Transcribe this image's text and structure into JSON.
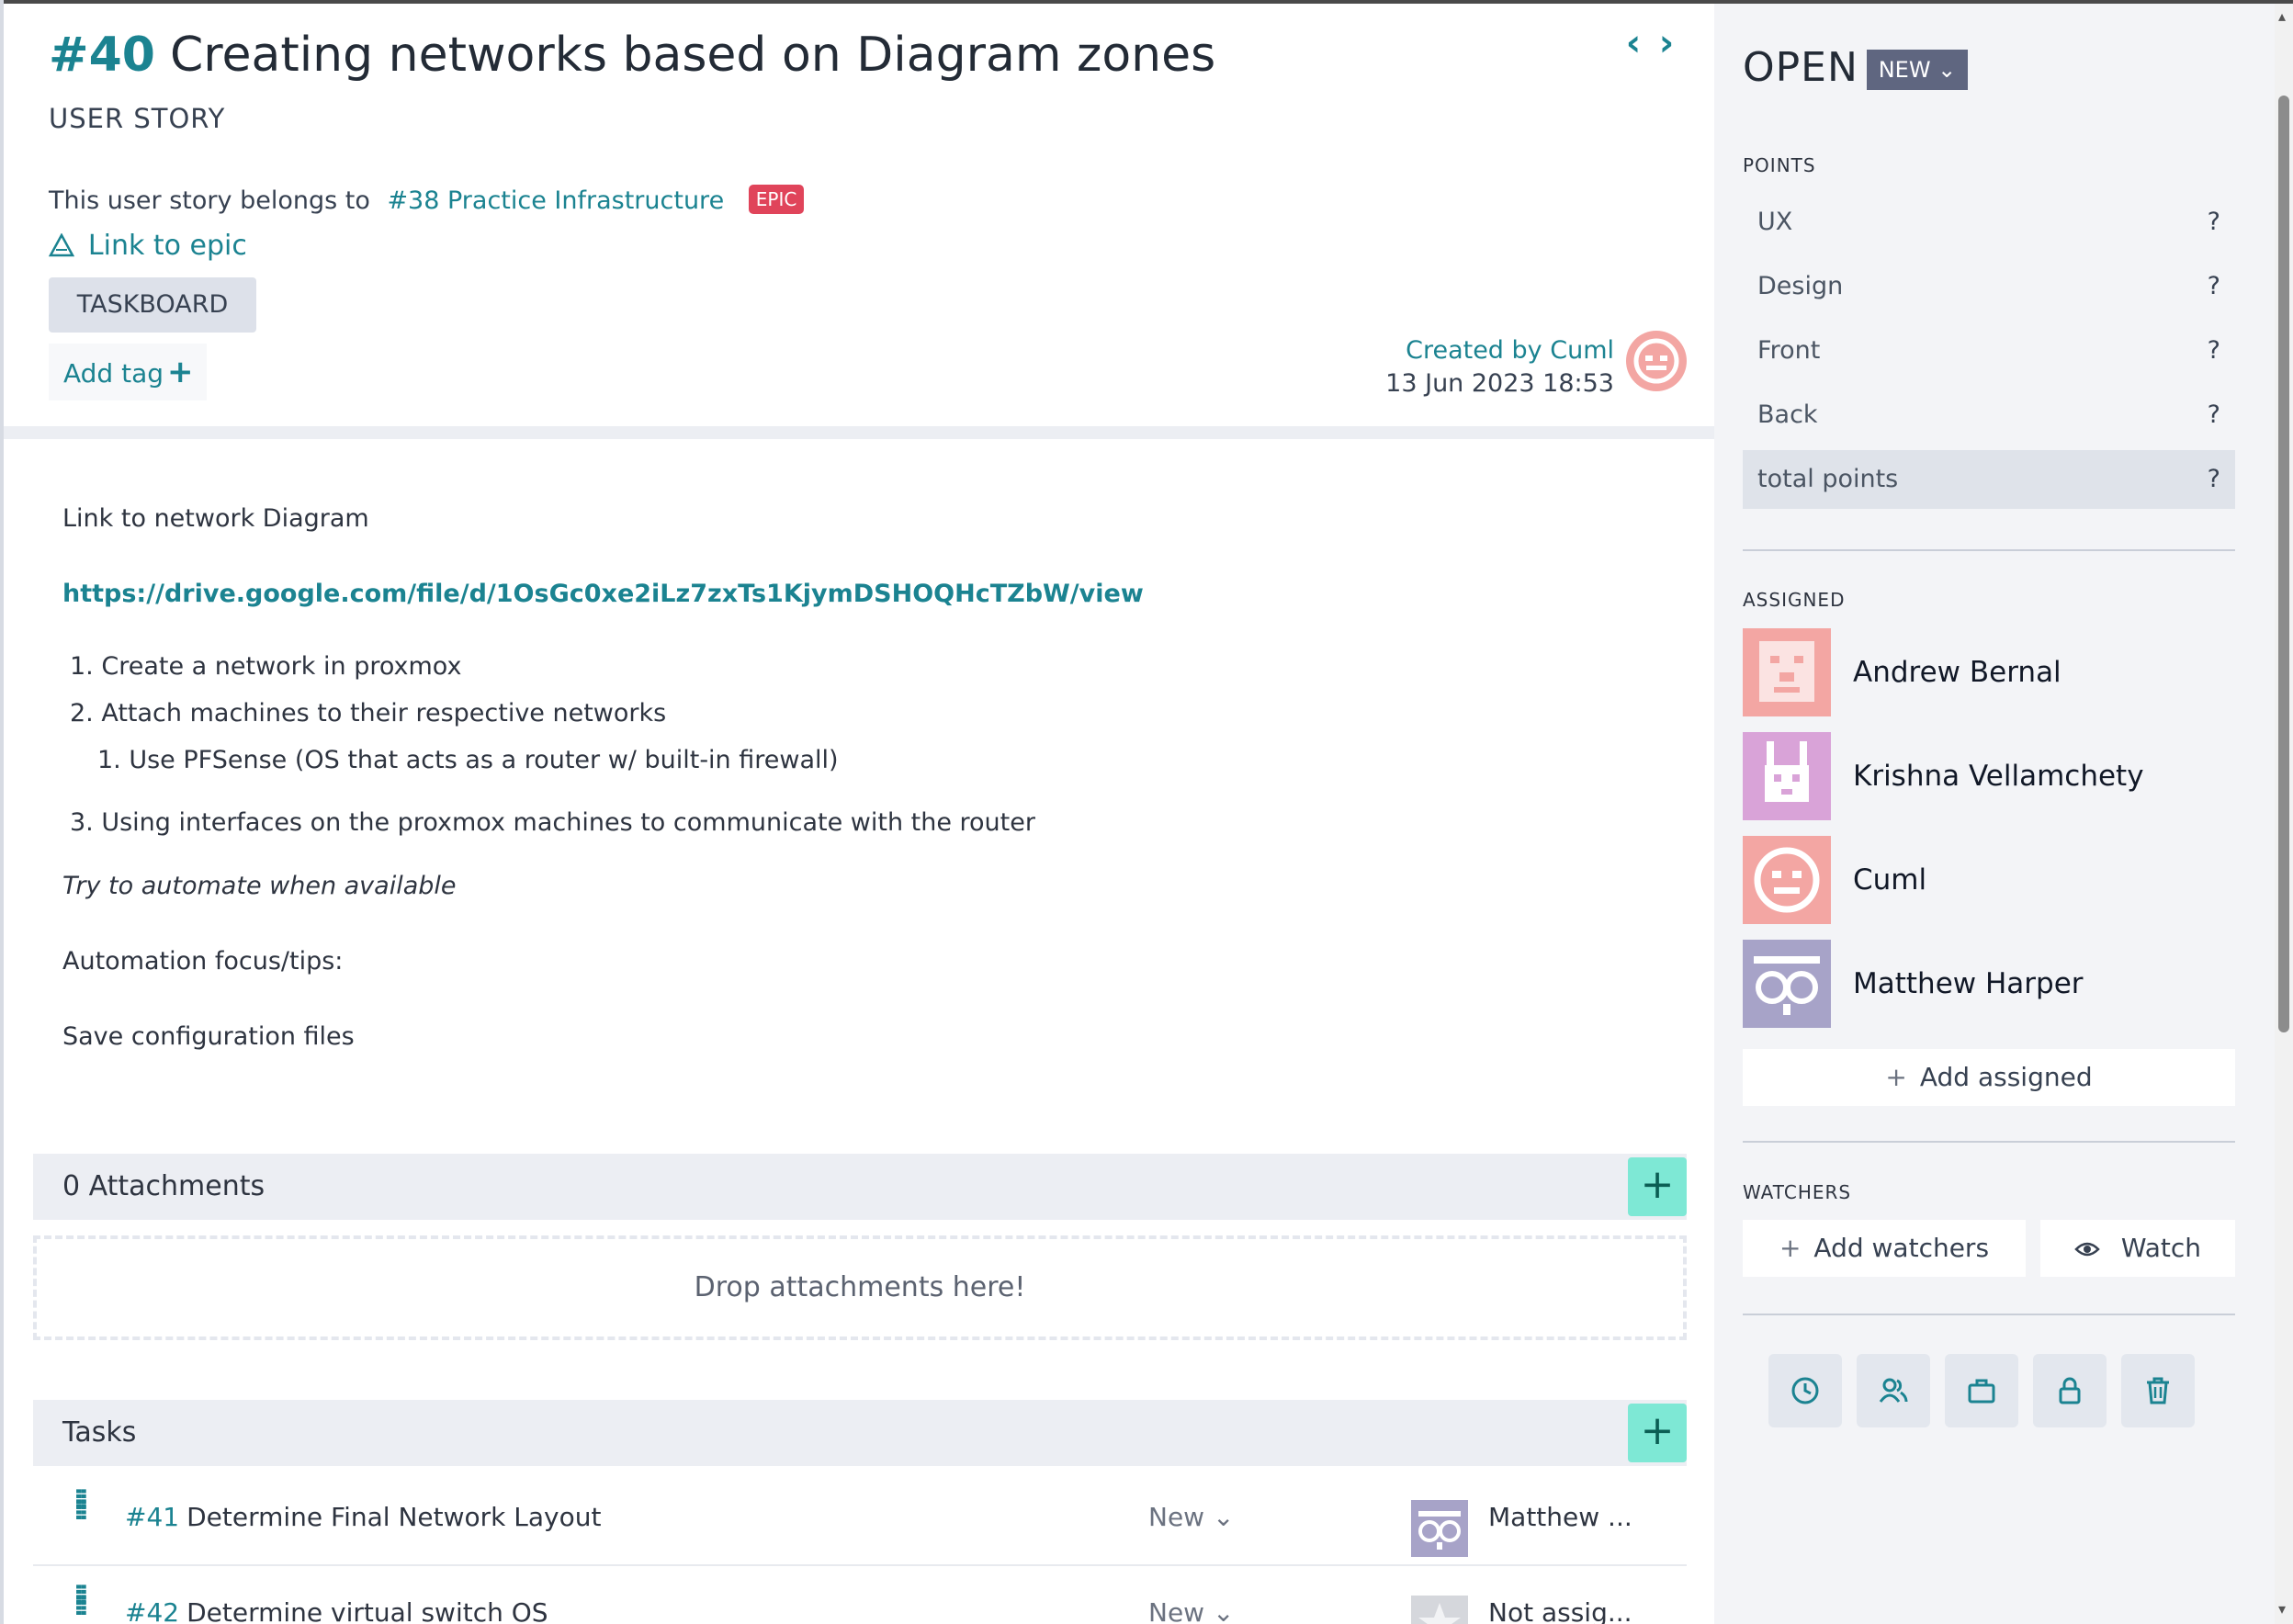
{
  "story": {
    "ref": "#40",
    "title": "Creating networks based on Diagram zones",
    "kind": "USER STORY",
    "belongs_text": "This user story belongs to",
    "epic_link": "#38 Practice Infrastructure",
    "epic_badge": "EPIC",
    "link_to_epic": "Link to epic",
    "taskboard": "TASKBOARD",
    "add_tag": "Add tag",
    "created_by": "Created by Cuml",
    "created_date": "13 Jun 2023 18:53"
  },
  "description": {
    "line1": "Link to network Diagram",
    "url": "https://drive.google.com/file/d/1OsGc0xe2iLz7zxTs1KjymDSHOQHcTZbW/view",
    "item1": "1. Create a network in proxmox",
    "item2": "2. Attach machines to their respective networks",
    "item2_sub": "1. Use PFSense (OS that acts as a router w/ built-in firewall)",
    "item3": "3. Using interfaces on the proxmox machines to communicate with the router",
    "italic": "Try to automate when available",
    "focus": "Automation focus/tips:",
    "save": "Save configuration files"
  },
  "attachments": {
    "label": "0 Attachments",
    "add": "+",
    "drop": "Drop attachments here!"
  },
  "tasks": {
    "label": "Tasks",
    "add": "+",
    "rows": [
      {
        "ref": "#41",
        "name": "Determine Final Network Layout",
        "status": "New ⌄",
        "assignee": "Matthew ..."
      },
      {
        "ref": "#42",
        "name": "Determine virtual switch OS",
        "status": "New ⌄",
        "assignee": "Not assig..."
      }
    ]
  },
  "sidebar": {
    "status": "OPEN",
    "status_badge": "NEW ⌄",
    "points_label": "POINTS",
    "points": [
      {
        "name": "UX",
        "value": "?"
      },
      {
        "name": "Design",
        "value": "?"
      },
      {
        "name": "Front",
        "value": "?"
      },
      {
        "name": "Back",
        "value": "?"
      },
      {
        "name": "total points",
        "value": "?"
      }
    ],
    "assigned_label": "ASSIGNED",
    "assigned": [
      "Andrew Bernal",
      "Krishna Vellamchety",
      "Cuml",
      "Matthew Harper"
    ],
    "add_assigned": "Add assigned",
    "watchers_label": "WATCHERS",
    "add_watchers": "Add watchers",
    "watch": "Watch"
  },
  "colors": {
    "accent": "#1b8391",
    "epic": "#e0445a",
    "add_button": "#7ee8d5",
    "status_badge": "#5f6680"
  },
  "icons": [
    "chevron-left-icon",
    "chevron-right-icon",
    "triangle-link-icon",
    "plus-icon",
    "drag-handle-icon",
    "eye-icon",
    "clock-icon",
    "people-icon",
    "briefcase-icon",
    "lock-icon",
    "trash-icon"
  ]
}
